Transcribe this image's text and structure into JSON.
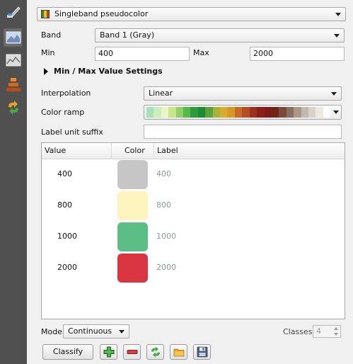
{
  "renderer": {
    "selected": "Singleband pseudocolor"
  },
  "band": {
    "label": "Band",
    "selected": "Band 1 (Gray)"
  },
  "min": {
    "label": "Min",
    "value": "400"
  },
  "max": {
    "label": "Max",
    "value": "2000"
  },
  "minmax_section": {
    "title": "Min / Max Value Settings"
  },
  "interpolation": {
    "label": "Interpolation",
    "selected": "Linear"
  },
  "color_ramp": {
    "label": "Color ramp",
    "colors": [
      "#a8e0b8",
      "#cdeeba",
      "#e9f6c8",
      "#c7e58d",
      "#8fcf6a",
      "#57b84a",
      "#2c9b3d",
      "#1f8a34",
      "#5aa23a",
      "#a6b33a",
      "#d8ad2d",
      "#d59829",
      "#c86a28",
      "#b44e23",
      "#9e2f1f",
      "#8a1f1a",
      "#7e1b1a",
      "#712518",
      "#7a4a3a",
      "#8a7060",
      "#a89888",
      "#c4b9b0",
      "#d8d2cc",
      "#ece9e5",
      "#ffffff"
    ]
  },
  "label_suffix": {
    "label": "Label unit suffix",
    "value": ""
  },
  "table": {
    "headers": {
      "value": "Value",
      "color": "Color",
      "label": "Label"
    },
    "rows": [
      {
        "value": "400",
        "color": "#c6c6c6",
        "label": "400"
      },
      {
        "value": "800",
        "color": "#fcf3bd",
        "label": "800"
      },
      {
        "value": "1000",
        "color": "#5dbd87",
        "label": "1000"
      },
      {
        "value": "2000",
        "color": "#d93642",
        "label": "2000"
      }
    ]
  },
  "mode": {
    "label": "Mode",
    "selected": "Continuous"
  },
  "classes": {
    "label": "Classes",
    "value": "4"
  },
  "buttons": {
    "classify": "Classify"
  },
  "icons": {
    "renderer": "pseudocolor-icon",
    "add": "add-icon",
    "remove": "remove-icon",
    "load": "load-from-band-icon",
    "open": "folder-icon",
    "save": "save-icon"
  }
}
